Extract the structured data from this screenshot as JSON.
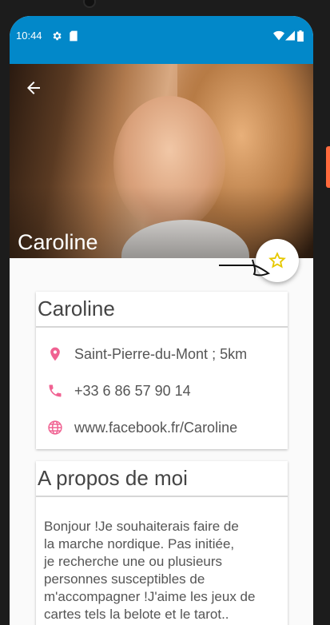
{
  "status_bar": {
    "time": "10:44"
  },
  "profile": {
    "hero_name": "Caroline",
    "card_name": "Caroline",
    "location": "Saint-Pierre-du-Mont ; 5km",
    "phone": "+33 6 86 57 90 14",
    "website": "www.facebook.fr/Caroline"
  },
  "about": {
    "title": "A propos de moi",
    "lines": [
      "Bonjour !Je souhaiterais faire de",
      "la marche nordique. Pas initiée,",
      "je recherche une ou plusieurs",
      "personnes susceptibles de",
      "m'accompagner !J'aime les jeux de",
      "cartes tels la belote et le tarot.."
    ]
  },
  "colors": {
    "status_bar": "#0288c9",
    "accent_pink": "#f06292",
    "star": "#f5d400"
  }
}
